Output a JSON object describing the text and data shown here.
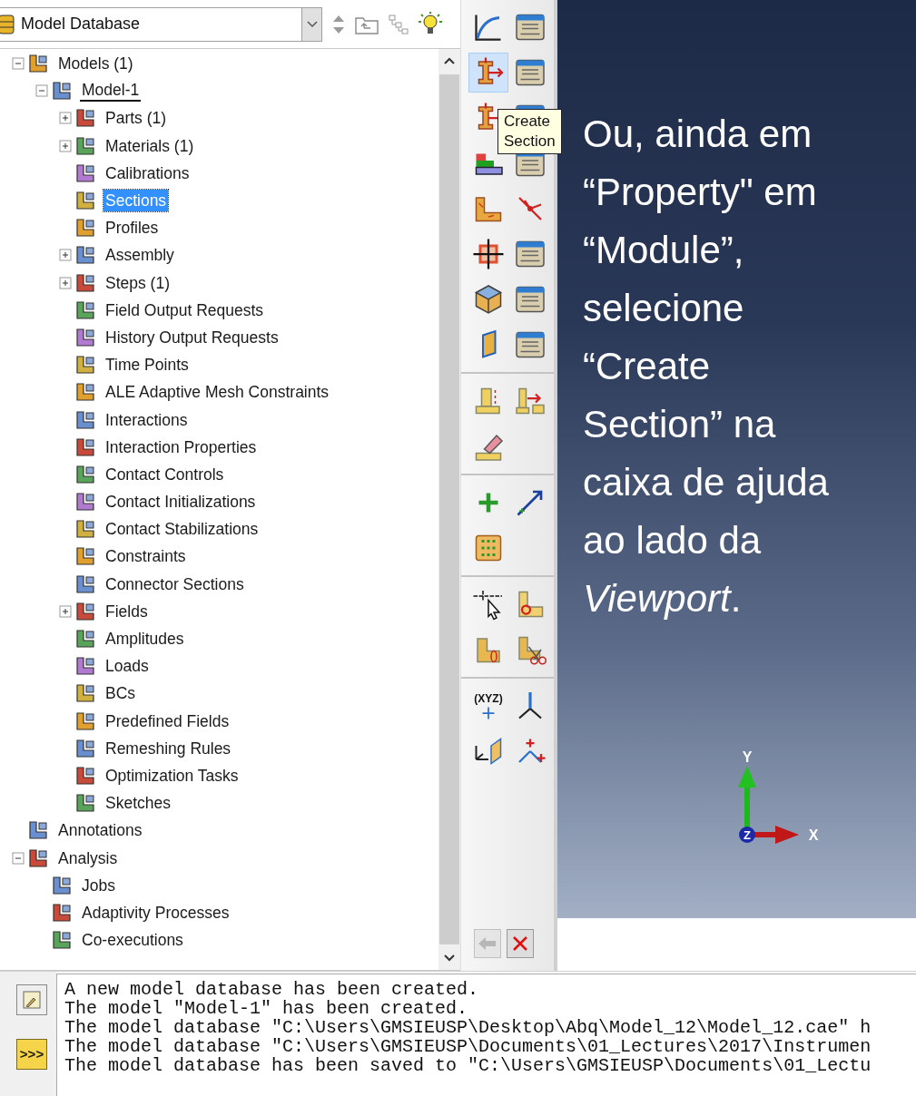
{
  "model_tree": {
    "selector": {
      "value": "Model Database"
    },
    "nodes": [
      {
        "label": "Models (1)",
        "expanded": true,
        "children": [
          {
            "label": "Model-1",
            "expanded": true,
            "current": true,
            "children": [
              {
                "label": "Parts (1)",
                "expanded": false
              },
              {
                "label": "Materials (1)",
                "expanded": false
              },
              {
                "label": "Calibrations"
              },
              {
                "label": "Sections",
                "selected": true
              },
              {
                "label": "Profiles"
              },
              {
                "label": "Assembly",
                "expanded": false
              },
              {
                "label": "Steps (1)",
                "expanded": false
              },
              {
                "label": "Field Output Requests"
              },
              {
                "label": "History Output Requests"
              },
              {
                "label": "Time Points"
              },
              {
                "label": "ALE Adaptive Mesh Constraints"
              },
              {
                "label": "Interactions"
              },
              {
                "label": "Interaction Properties"
              },
              {
                "label": "Contact Controls"
              },
              {
                "label": "Contact Initializations"
              },
              {
                "label": "Contact Stabilizations"
              },
              {
                "label": "Constraints"
              },
              {
                "label": "Connector Sections"
              },
              {
                "label": "Fields",
                "expanded": false
              },
              {
                "label": "Amplitudes"
              },
              {
                "label": "Loads"
              },
              {
                "label": "BCs"
              },
              {
                "label": "Predefined Fields"
              },
              {
                "label": "Remeshing Rules"
              },
              {
                "label": "Optimization Tasks"
              },
              {
                "label": "Sketches"
              }
            ]
          }
        ]
      },
      {
        "label": "Annotations"
      },
      {
        "label": "Analysis",
        "expanded": true,
        "children": [
          {
            "label": "Jobs"
          },
          {
            "label": "Adaptivity Processes"
          },
          {
            "label": "Co-executions"
          }
        ]
      }
    ]
  },
  "toolbox": {
    "tooltip": "Create Section",
    "groups": [
      [
        {
          "highlighted": false
        },
        {
          "highlighted": false
        },
        {
          "highlighted": true
        },
        {
          "highlighted": false
        },
        {
          "highlighted": false
        },
        {
          "highlighted": false
        },
        {
          "highlighted": false
        },
        {
          "highlighted": false
        },
        {
          "highlighted": false
        },
        {
          "highlighted": false
        },
        {
          "highlighted": false
        },
        {
          "highlighted": false
        },
        {
          "highlighted": false
        },
        {
          "highlighted": false
        },
        {
          "highlighted": false
        },
        {
          "highlighted": false
        }
      ],
      [
        {
          "highlighted": false
        },
        {
          "highlighted": false
        },
        {
          "highlighted": false
        }
      ],
      [
        {
          "highlighted": false
        },
        {
          "highlighted": false
        },
        {
          "highlighted": false
        }
      ],
      [
        {
          "highlighted": false
        },
        {
          "highlighted": false
        },
        {
          "highlighted": false
        },
        {
          "highlighted": false
        }
      ],
      [
        {
          "highlighted": false,
          "label": "(XYZ)"
        },
        {
          "highlighted": false
        },
        {
          "highlighted": false
        },
        {
          "highlighted": false
        }
      ]
    ],
    "prompt_buttons": [
      {
        "kind": "back",
        "disabled": true
      },
      {
        "kind": "cancel",
        "disabled": false
      }
    ]
  },
  "viewport": {
    "note_lines": [
      "Ou, ainda em",
      "“Property\" em",
      "“Module”,",
      "selecione",
      "“Create",
      "Section” na",
      "caixa de ajuda",
      "ao lado da",
      "*Viewport*."
    ],
    "triad": {
      "x": "X",
      "y": "Y",
      "z": "Z"
    }
  },
  "message_area": {
    "command_button": ">>>",
    "lines": [
      "A new model database has been created.",
      "The model \"Model-1\" has been created.",
      "The model database \"C:\\Users\\GMSIEUSP\\Desktop\\Abq\\Model_12\\Model_12.cae\" h",
      "The model database \"C:\\Users\\GMSIEUSP\\Documents\\01_Lectures\\2017\\Instrumen",
      "The model database has been saved to \"C:\\Users\\GMSIEUSP\\Documents\\01_Lectu"
    ]
  }
}
